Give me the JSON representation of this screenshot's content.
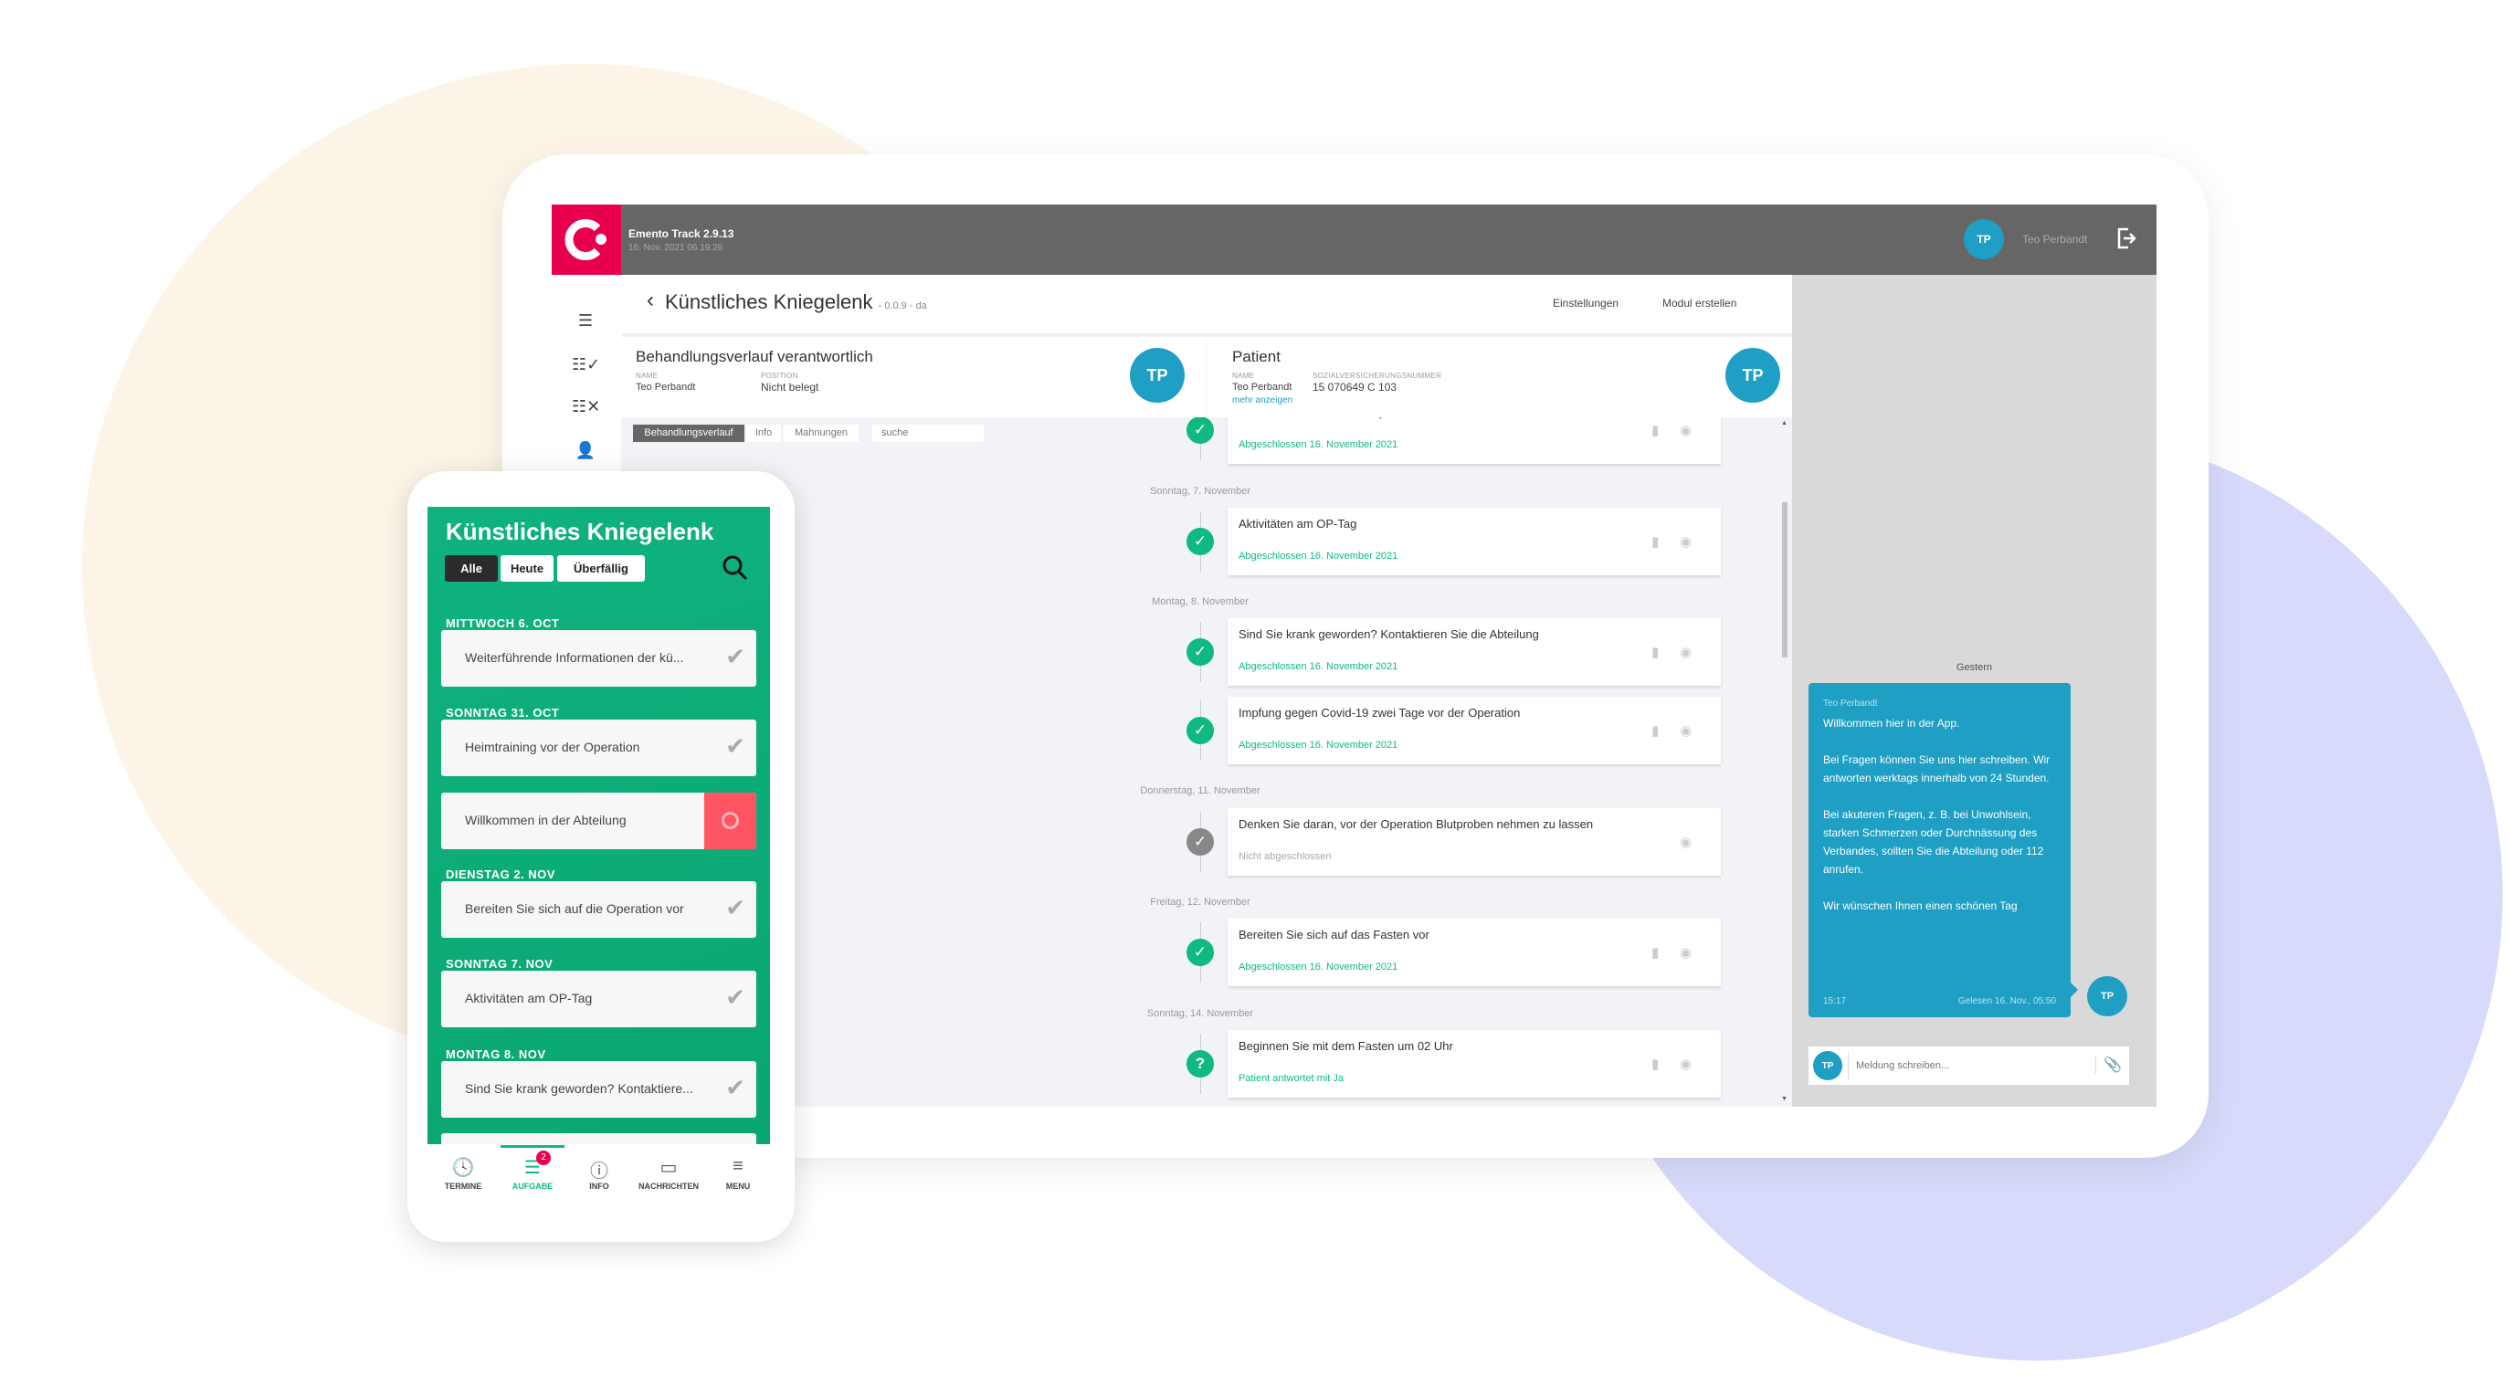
{
  "colors": {
    "brand": "#e8004f",
    "accent": "#1e9fc3",
    "success": "#10b981",
    "alert": "#ff5563",
    "mobile_bg": "#0fb27f"
  },
  "app": {
    "name": "Emento Track 2.9.13",
    "datetime": "16. Nov. 2021 06.19.26",
    "user_initials": "TP",
    "user_name": "Teo Perbandt"
  },
  "sidebar": {
    "icons": [
      "list-icon",
      "list-check-icon",
      "list-cancel-icon",
      "add-user-icon"
    ]
  },
  "header": {
    "title": "Künstliches Kniegelenk",
    "version": "- 0.0.9 - da",
    "settings": "Einstellungen",
    "create_module": "Modul erstellen"
  },
  "responsible": {
    "title": "Behandlungsverlauf verantwortlich",
    "name_label": "NAME",
    "name": "Teo Perbandt",
    "position_label": "POSITION",
    "position": "Nicht belegt",
    "initials": "TP"
  },
  "patient": {
    "title": "Patient",
    "name_label": "NAME",
    "name": "Teo Perbandt",
    "ssn_label": "SOZIALVERSICHERUNGSNUMMER",
    "ssn": "15 070649 C 103",
    "more": "mehr anzeigen",
    "initials": "TP"
  },
  "tabs": [
    {
      "label": "Behandlungsverlauf",
      "active": true
    },
    {
      "label": "Info"
    },
    {
      "label": "Mahnungen"
    }
  ],
  "search": {
    "placeholder": "suche"
  },
  "timeline": [
    {
      "date": "",
      "title": "Bereiten Sie sich auf die Operation vor",
      "status": "Abgeschlossen 16. November 2021",
      "state": "done"
    },
    {
      "date": "Sonntag, 7. November",
      "title": "Aktivitäten am OP-Tag",
      "status": "Abgeschlossen 16. November 2021",
      "state": "done"
    },
    {
      "date": "Montag, 8. November",
      "title": "Sind Sie krank geworden? Kontaktieren Sie die Abteilung",
      "status": "Abgeschlossen 16. November 2021",
      "state": "done"
    },
    {
      "date": "",
      "title": "Impfung gegen Covid-19 zwei Tage vor der Operation",
      "status": "Abgeschlossen 16. November 2021",
      "state": "done"
    },
    {
      "date": "Donnerstag, 11. November",
      "title": "Denken Sie daran, vor der Operation Blutproben nehmen zu lassen",
      "status": "Nicht abgeschlossen",
      "state": "open"
    },
    {
      "date": "Freitag, 12. November",
      "title": "Bereiten Sie sich auf das Fasten vor",
      "status": "Abgeschlossen 16. November 2021",
      "state": "done"
    },
    {
      "date": "Sonntag, 14. November",
      "title": "Beginnen Sie mit dem Fasten um 02 Uhr",
      "status": "Patient antwortet mit Ja",
      "state": "question"
    }
  ],
  "chat": {
    "day": "Gestern",
    "message": {
      "sender": "Teo Perbandt",
      "paragraphs": [
        "Willkommen hier in der App.",
        "Bei Fragen können Sie uns hier schreiben. Wir antworten werktags innerhalb von 24 Stunden.",
        "Bei akuteren Fragen, z. B. bei Unwohlsein, starken Schmerzen oder Durchnässung des Verbandes, sollten Sie die Abteilung oder 112 anrufen.",
        "Wir wünschen Ihnen einen schönen Tag"
      ],
      "time": "15:17",
      "read": "Gelesen 16. Nov., 05:50",
      "initials": "TP"
    },
    "input_placeholder": "Meldung schreiben...",
    "input_initials": "TP"
  },
  "mobile": {
    "title": "Künstliches Kniegelenk",
    "filters": [
      {
        "label": "Alle",
        "active": true
      },
      {
        "label": "Heute"
      },
      {
        "label": "Überfällig"
      }
    ],
    "sections": [
      {
        "heading": "MITTWOCH 6. OCT",
        "items": [
          {
            "text": "Weiterführende Informationen der kü...",
            "state": "done"
          }
        ]
      },
      {
        "heading": "SONNTAG 31. OCT",
        "items": [
          {
            "text": "Heimtraining vor der Operation",
            "state": "done"
          },
          {
            "text": "Willkommen in der Abteilung",
            "state": "open"
          }
        ]
      },
      {
        "heading": "DIENSTAG 2. NOV",
        "items": [
          {
            "text": "Bereiten Sie sich auf die Operation vor",
            "state": "done"
          }
        ]
      },
      {
        "heading": "SONNTAG 7. NOV",
        "items": [
          {
            "text": "Aktivitäten am OP-Tag",
            "state": "done"
          }
        ]
      },
      {
        "heading": "MONTAG 8. NOV",
        "items": [
          {
            "text": "Sind Sie krank geworden? Kontaktiere...",
            "state": "done"
          }
        ]
      }
    ],
    "nav": [
      {
        "label": "TERMINE",
        "icon": "clock-icon"
      },
      {
        "label": "AUFGABE",
        "icon": "tasks-icon",
        "active": true,
        "badge": "2"
      },
      {
        "label": "INFO",
        "icon": "info-icon"
      },
      {
        "label": "NACHRICHTEN",
        "icon": "message-icon"
      },
      {
        "label": "MENU",
        "icon": "menu-icon"
      }
    ]
  }
}
